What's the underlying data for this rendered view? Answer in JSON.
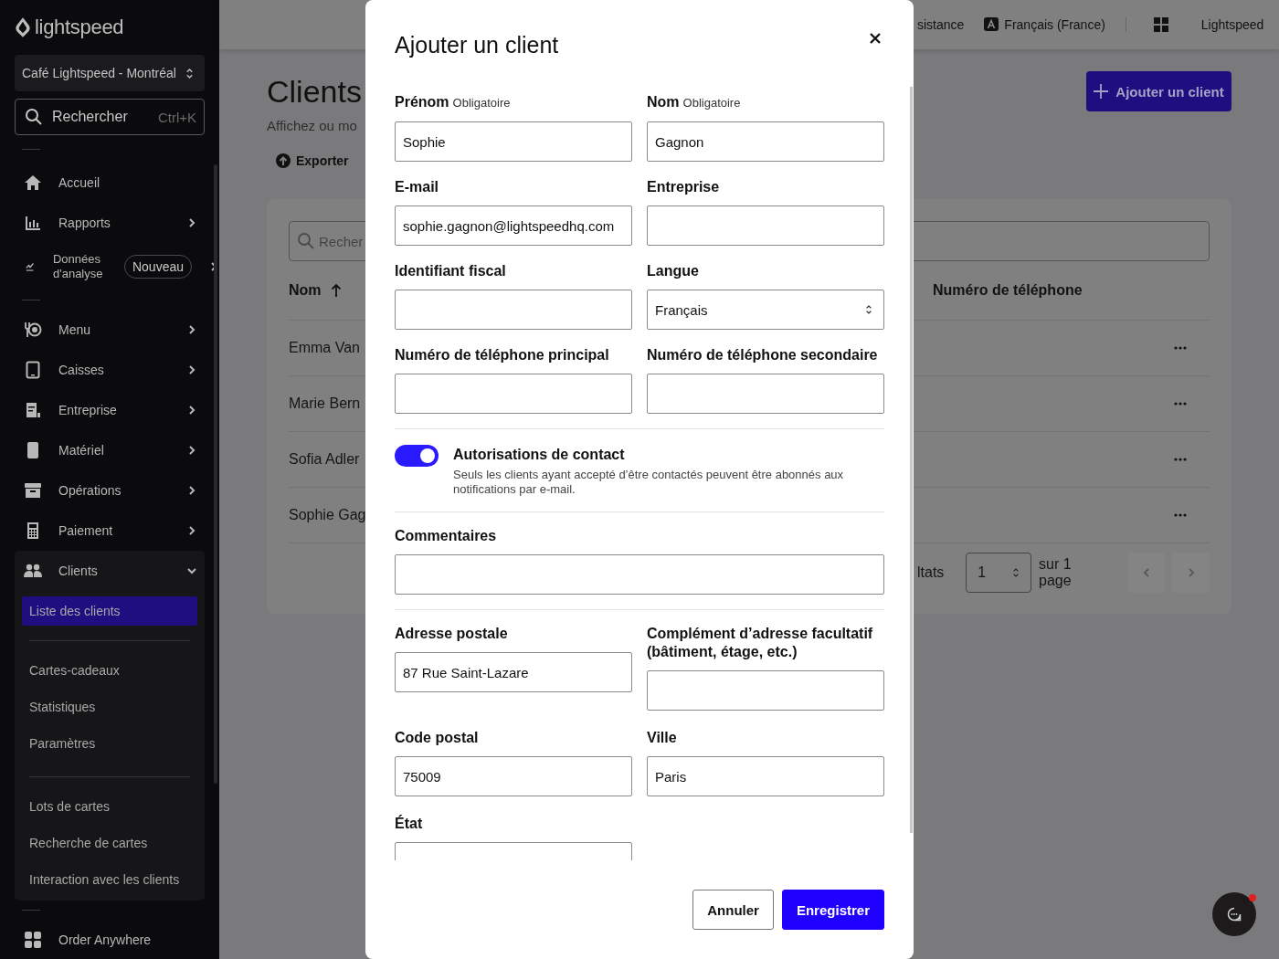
{
  "sidebar": {
    "logo": "lightspeed",
    "location": "Café Lightspeed - Montréal",
    "search": {
      "placeholder": "Rechercher",
      "shortcut": "Ctrl+K"
    },
    "sections": [
      {
        "items": [
          {
            "label": "Accueil",
            "submenu": false
          },
          {
            "label": "Rapports",
            "submenu": true
          },
          {
            "label": "Données d'analyse",
            "submenu": true,
            "badge": "Nouveau"
          }
        ]
      },
      {
        "items": [
          {
            "label": "Menu",
            "submenu": true
          },
          {
            "label": "Caisses",
            "submenu": true
          },
          {
            "label": "Entreprise",
            "submenu": true
          },
          {
            "label": "Matériel",
            "submenu": true
          },
          {
            "label": "Opérations",
            "submenu": true
          },
          {
            "label": "Paiement",
            "submenu": true
          },
          {
            "label": "Clients",
            "submenu": true,
            "expanded": true,
            "groups": [
              {
                "children": [
                  {
                    "label": "Liste des clients",
                    "selected": true
                  }
                ]
              },
              {
                "children": [
                  {
                    "label": "Cartes-cadeaux",
                    "selected": false
                  },
                  {
                    "label": "Statistiques",
                    "selected": false
                  },
                  {
                    "label": "Paramètres",
                    "selected": false
                  }
                ]
              },
              {
                "children": [
                  {
                    "label": "Lots de cartes",
                    "selected": false
                  },
                  {
                    "label": "Recherche de cartes",
                    "selected": false
                  },
                  {
                    "label": "Interaction avec les clients",
                    "selected": false
                  }
                ]
              }
            ]
          }
        ]
      },
      {
        "items": [
          {
            "label": "Order Anywhere",
            "submenu": false
          }
        ]
      }
    ]
  },
  "topbar": {
    "help": "sistance",
    "language": "Français (France)",
    "account": "Lightspeed"
  },
  "page": {
    "title": "Clients",
    "subtitle": "Affichez ou mo",
    "export": "Exporter",
    "add_button": "Ajouter un client"
  },
  "table": {
    "search_placeholder": "Recher",
    "columns": [
      {
        "label": "Nom",
        "sorted": true
      },
      {
        "label": "Numéro de téléphone"
      }
    ],
    "rows": [
      {
        "name": "Emma Van"
      },
      {
        "name": "Marie Bern"
      },
      {
        "name": "Sofia Adler"
      },
      {
        "name": "Sophie Gag"
      }
    ],
    "pagination": {
      "results_text": "ltats",
      "page": "1",
      "of_pages": "sur 1 page",
      "prev_disabled": true,
      "next_disabled": true
    }
  },
  "chat": {
    "unread": true
  },
  "modal": {
    "title": "Ajouter un client",
    "fields": [
      {
        "label": "Prénom",
        "note": "Obligatoire",
        "kind": "text",
        "value": "Sophie"
      },
      {
        "label": "Nom",
        "note": "Obligatoire",
        "kind": "text",
        "value": "Gagnon"
      },
      {
        "label": "E-mail",
        "kind": "text",
        "value": "sophie.gagnon@lightspeedhq.com"
      },
      {
        "label": "Entreprise",
        "kind": "text"
      },
      {
        "label": "Identifiant fiscal",
        "kind": "text"
      },
      {
        "label": "Langue",
        "kind": "select",
        "value": "Français"
      },
      {
        "label": "Numéro de téléphone principal",
        "kind": "text"
      },
      {
        "label": "Numéro de téléphone secondaire",
        "kind": "text"
      }
    ],
    "contact_toggle": {
      "label": "Autorisations de contact",
      "description": "Seuls les clients ayant accepté d’être contactés peuvent être abonnés aux notifications par e-mail.",
      "on": true
    },
    "comments": {
      "label": "Commentaires"
    },
    "address_fields": [
      {
        "label": "Adresse postale",
        "value": "87 Rue Saint-Lazare"
      },
      {
        "label": "Complément d’adresse facultatif (bâtiment, étage, etc.)"
      },
      {
        "label": "Code postal",
        "value": "75009"
      },
      {
        "label": "Ville",
        "value": "Paris"
      },
      {
        "label": "État"
      }
    ],
    "buttons": {
      "cancel": "Annuler",
      "save": "Enregistrer"
    }
  }
}
